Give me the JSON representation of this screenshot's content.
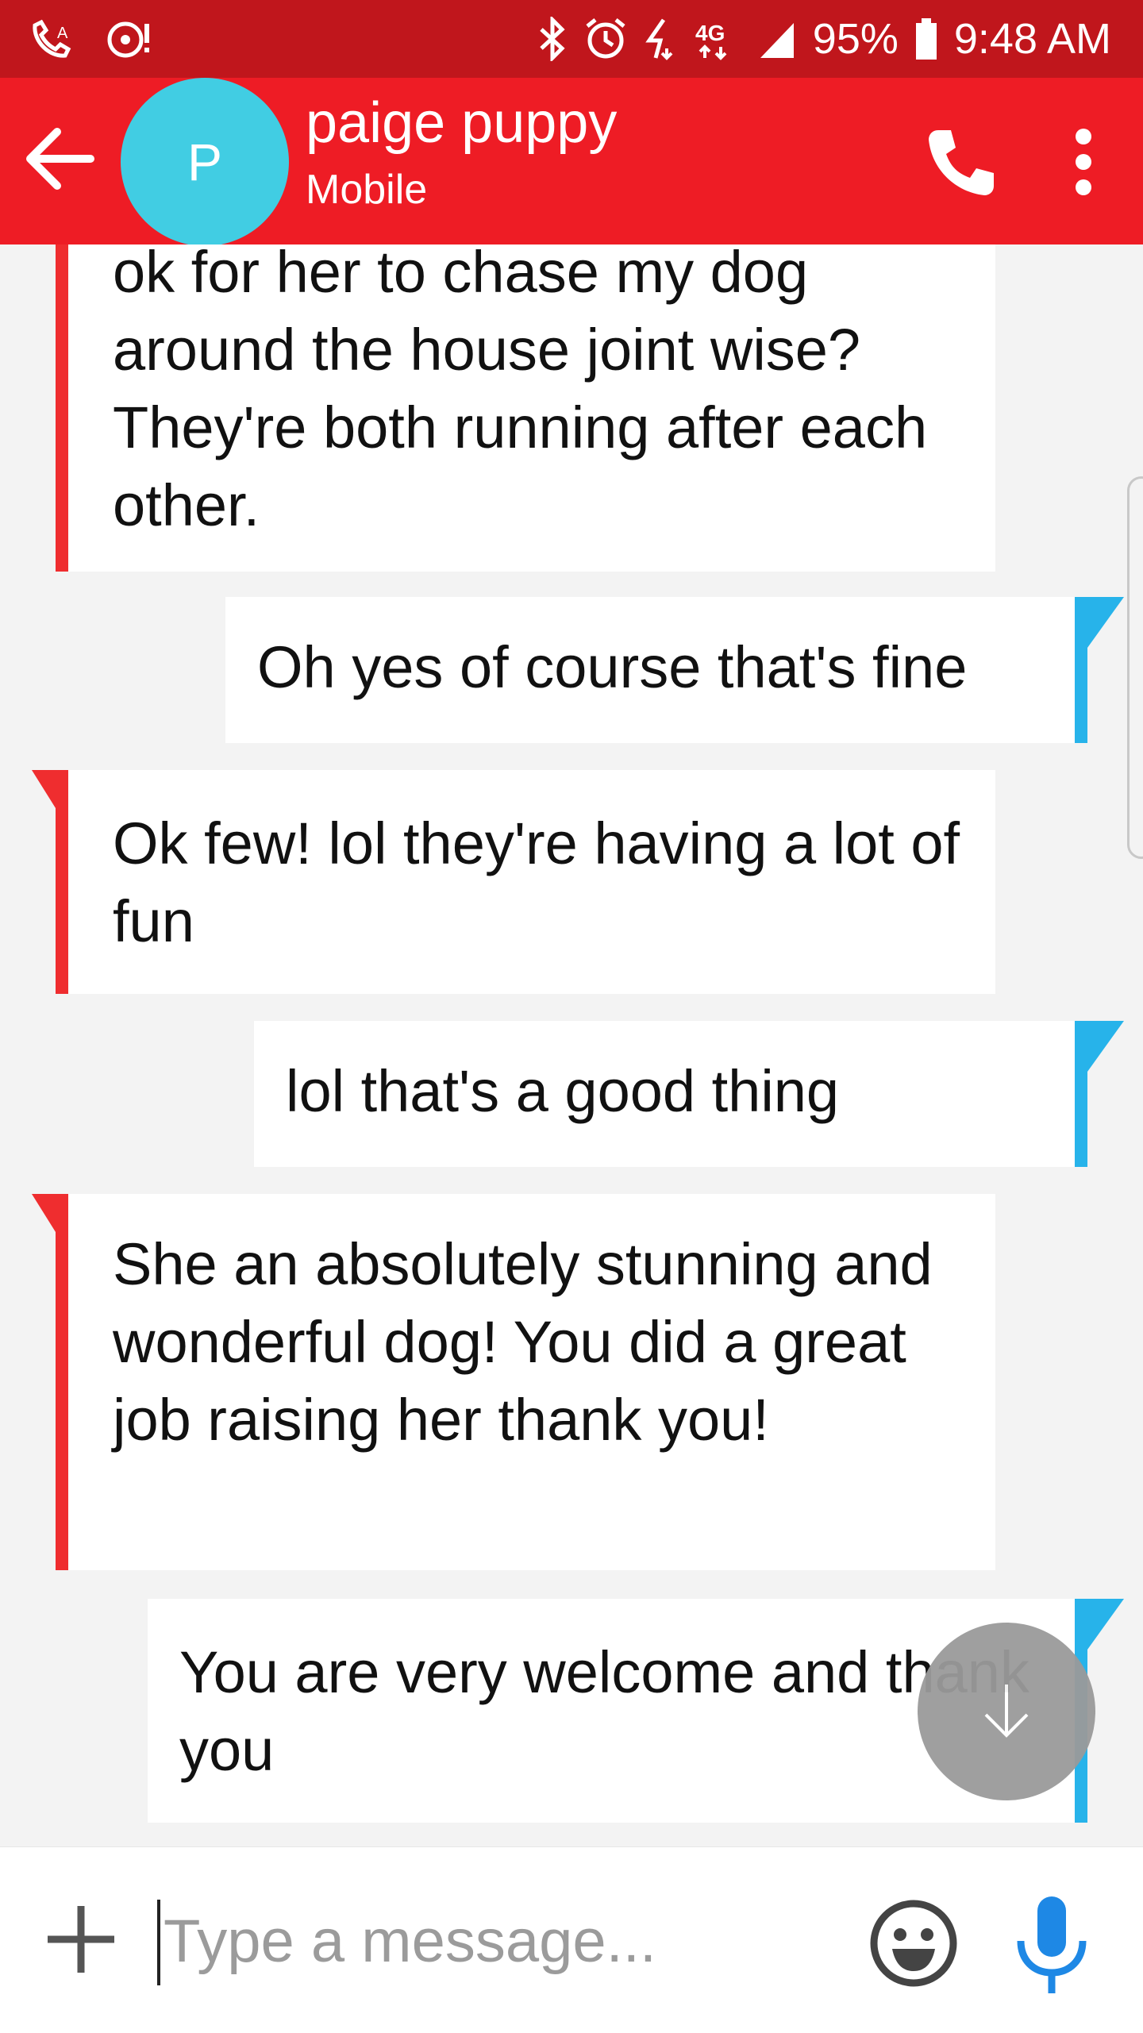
{
  "status_bar": {
    "battery": "95%",
    "time": "9:48 AM",
    "network": "4G",
    "left_icons": [
      "wifi-calling-icon",
      "media-notification-icon"
    ],
    "right_icons": [
      "bluetooth-icon",
      "alarm-icon",
      "data-saver-icon",
      "4g-lte-icon",
      "signal-icon",
      "battery-icon"
    ]
  },
  "header": {
    "avatar_letter": "P",
    "contact_name": "paige puppy",
    "contact_type": "Mobile",
    "avatar_color": "#41cde3",
    "bar_color": "#ee1c25"
  },
  "messages": [
    {
      "direction": "incoming",
      "text": "ok for her to chase my dog around the house joint wise? They're both running after each other."
    },
    {
      "direction": "outgoing",
      "text": "Oh yes of course that's fine"
    },
    {
      "direction": "incoming",
      "text": "Ok few! lol they're having a lot of fun"
    },
    {
      "direction": "outgoing",
      "text": "lol that's a good thing"
    },
    {
      "direction": "incoming",
      "text": "She an absolutely stunning and wonderful dog! You did a great job raising her thank you!"
    },
    {
      "direction": "outgoing",
      "text": "You are very welcome and thank you"
    }
  ],
  "composer": {
    "placeholder": "Type a message...",
    "value": ""
  },
  "colors": {
    "incoming_accent": "#ef2d2f",
    "outgoing_accent": "#27b3ea",
    "mic": "#1e88e5"
  }
}
